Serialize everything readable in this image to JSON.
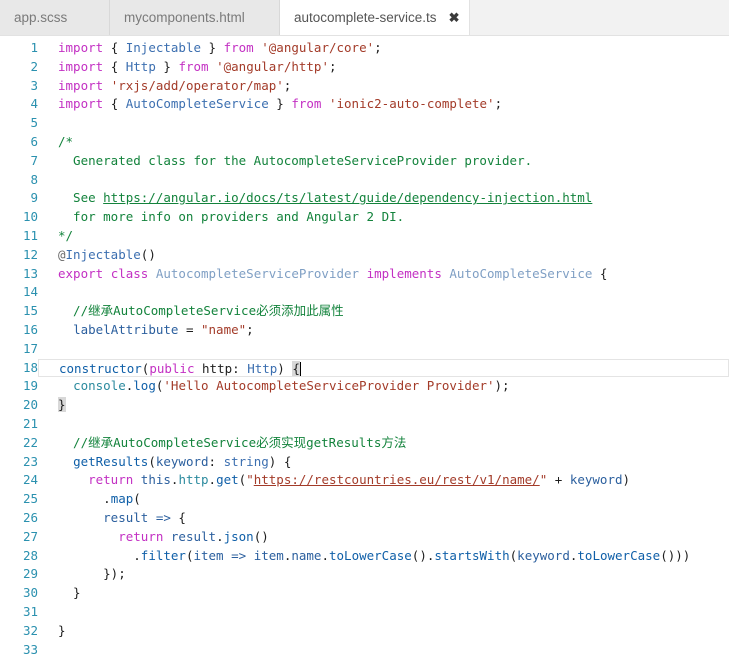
{
  "window": {
    "app": "code-editor"
  },
  "tabs": [
    {
      "label": "app.scss",
      "active": false,
      "closable": false
    },
    {
      "label": "mycomponents.html",
      "active": false,
      "closable": false
    },
    {
      "label": "autocomplete-service.ts",
      "active": true,
      "closable": true,
      "close_glyph": "✖"
    }
  ],
  "editor": {
    "current_line": 18,
    "total_lines_visible": 33,
    "gutter_color": "#2b91af",
    "comment_color": "#13833c",
    "keyword_color": "#c330c3",
    "string_color": "#a33b29",
    "type_color": "#3c6fb0",
    "lines": [
      {
        "n": 1,
        "text": "import { Injectable } from '@angular/core';"
      },
      {
        "n": 2,
        "text": "import { Http } from '@angular/http';"
      },
      {
        "n": 3,
        "text": "import 'rxjs/add/operator/map';"
      },
      {
        "n": 4,
        "text": "import { AutoCompleteService } from 'ionic2-auto-complete';"
      },
      {
        "n": 5,
        "text": ""
      },
      {
        "n": 6,
        "text": "/*"
      },
      {
        "n": 7,
        "text": "  Generated class for the AutocompleteServiceProvider provider."
      },
      {
        "n": 8,
        "text": ""
      },
      {
        "n": 9,
        "text": "  See https://angular.io/docs/ts/latest/guide/dependency-injection.html"
      },
      {
        "n": 10,
        "text": "  for more info on providers and Angular 2 DI."
      },
      {
        "n": 11,
        "text": "*/"
      },
      {
        "n": 12,
        "text": "@Injectable()"
      },
      {
        "n": 13,
        "text": "export class AutocompleteServiceProvider implements AutoCompleteService {"
      },
      {
        "n": 14,
        "text": ""
      },
      {
        "n": 15,
        "text": "  //继承AutoCompleteService必须添加此属性"
      },
      {
        "n": 16,
        "text": "  labelAttribute = \"name\";"
      },
      {
        "n": 17,
        "text": ""
      },
      {
        "n": 18,
        "text": "  constructor(public http: Http) {"
      },
      {
        "n": 19,
        "text": "    console.log('Hello AutocompleteServiceProvider Provider');"
      },
      {
        "n": 20,
        "text": "  }"
      },
      {
        "n": 21,
        "text": ""
      },
      {
        "n": 22,
        "text": "  //继承AutoCompleteService必须实现getResults方法"
      },
      {
        "n": 23,
        "text": "  getResults(keyword: string) {"
      },
      {
        "n": 24,
        "text": "    return this.http.get(\"https://restcountries.eu/rest/v1/name/\" + keyword)"
      },
      {
        "n": 25,
        "text": "      .map("
      },
      {
        "n": 26,
        "text": "      result => {"
      },
      {
        "n": 27,
        "text": "        return result.json()"
      },
      {
        "n": 28,
        "text": "          .filter(item => item.name.toLowerCase().startsWith(keyword.toLowerCase()))"
      },
      {
        "n": 29,
        "text": "      });"
      },
      {
        "n": 30,
        "text": "  }"
      },
      {
        "n": 31,
        "text": ""
      },
      {
        "n": 32,
        "text": "}"
      },
      {
        "n": 33,
        "text": ""
      }
    ],
    "links": [
      "https://angular.io/docs/ts/latest/guide/dependency-injection.html",
      "https://restcountries.eu/rest/v1/name/"
    ]
  }
}
